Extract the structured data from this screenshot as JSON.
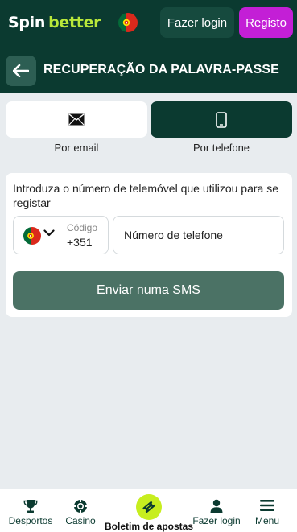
{
  "header": {
    "logo_spin": "Spin",
    "logo_better": "better",
    "login_label": "Fazer login",
    "register_label": "Registo"
  },
  "titlebar": {
    "title": "RECUPERAÇÃO DA PALAVRA-PASSE"
  },
  "tabs": [
    {
      "label": "Por email",
      "icon": "envelope-icon",
      "selected": false
    },
    {
      "label": "Por telefone",
      "icon": "phone-icon",
      "selected": true
    }
  ],
  "form": {
    "instruction": "Introduza o número de telemóvel que utilizou para se registar",
    "code_label": "Código",
    "code_value": "+351",
    "phone_placeholder": "Número de telefone",
    "phone_value": "",
    "submit_label": "Enviar numa SMS"
  },
  "bottom_nav": [
    {
      "label": "Desportos",
      "icon": "trophy-icon"
    },
    {
      "label": "Casino",
      "icon": "casino-chip-icon"
    },
    {
      "label": "Boletim de apostas",
      "icon": "ticket-icon"
    },
    {
      "label": "Fazer login",
      "icon": "user-icon"
    },
    {
      "label": "Menu",
      "icon": "hamburger-icon"
    }
  ],
  "colors": {
    "header_bg": "#0b3a30",
    "accent_green": "#b9e83a",
    "register_purple": "#c31fd6",
    "submit_bg": "#4b7265",
    "boletim_yellow": "#c7ee1f"
  }
}
